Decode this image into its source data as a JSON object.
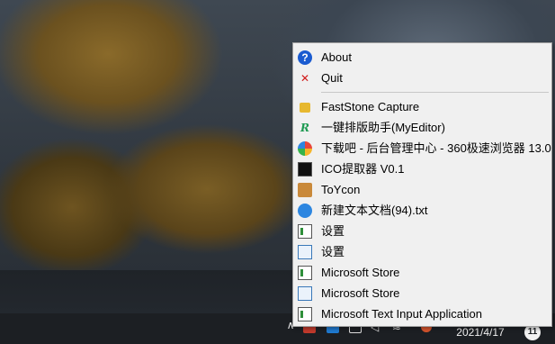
{
  "menu": {
    "items": [
      {
        "label": "About",
        "icon": "help-icon"
      },
      {
        "label": "Quit",
        "icon": "close-icon"
      },
      {
        "label": "FastStone Capture",
        "icon": "lock-icon"
      },
      {
        "label": "一键排版助手(MyEditor)",
        "icon": "r-logo-icon"
      },
      {
        "label": "下载吧 - 后台管理中心 - 360极速浏览器 13.0",
        "icon": "browser-360-icon"
      },
      {
        "label": "ICO提取器 V0.1",
        "icon": "ico-extractor-icon"
      },
      {
        "label": "ToYcon",
        "icon": "toycon-icon"
      },
      {
        "label": "新建文本文档(94).txt",
        "icon": "text-document-icon"
      },
      {
        "label": "设置",
        "icon": "settings-window-icon"
      },
      {
        "label": "设置",
        "icon": "settings-window-alt-icon"
      },
      {
        "label": "Microsoft Store",
        "icon": "store-window-icon"
      },
      {
        "label": "Microsoft Store",
        "icon": "store-window-alt-icon"
      },
      {
        "label": "Microsoft Text Input Application",
        "icon": "text-input-window-icon"
      }
    ]
  },
  "taskbar": {
    "date": "2021/4/17",
    "notification_count": "11",
    "tray_chevron": "∧"
  }
}
